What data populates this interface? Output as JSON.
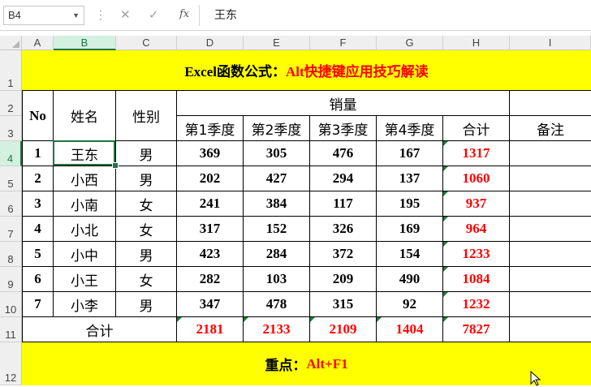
{
  "formula_bar": {
    "name_box": "B4",
    "formula_value": "王东"
  },
  "columns": [
    "A",
    "B",
    "C",
    "D",
    "E",
    "F",
    "G",
    "H",
    "I"
  ],
  "rows": [
    "1",
    "2",
    "3",
    "4",
    "5",
    "6",
    "7",
    "8",
    "9",
    "10",
    "11",
    "12"
  ],
  "sheet": {
    "title_part1": "Excel函数公式：",
    "title_part2": "Alt快捷键应用技巧解读",
    "headers": {
      "no": "No",
      "name": "姓名",
      "gender": "性别",
      "sales": "销量",
      "q1": "第1季度",
      "q2": "第2季度",
      "q3": "第3季度",
      "q4": "第4季度",
      "total": "合计",
      "remark": "备注"
    },
    "data": [
      {
        "no": "1",
        "name": "王东",
        "gender": "男",
        "q1": "369",
        "q2": "305",
        "q3": "476",
        "q4": "167",
        "total": "1317"
      },
      {
        "no": "2",
        "name": "小西",
        "gender": "男",
        "q1": "202",
        "q2": "427",
        "q3": "294",
        "q4": "137",
        "total": "1060"
      },
      {
        "no": "3",
        "name": "小南",
        "gender": "女",
        "q1": "241",
        "q2": "384",
        "q3": "117",
        "q4": "195",
        "total": "937"
      },
      {
        "no": "4",
        "name": "小北",
        "gender": "女",
        "q1": "317",
        "q2": "152",
        "q3": "326",
        "q4": "169",
        "total": "964"
      },
      {
        "no": "5",
        "name": "小中",
        "gender": "男",
        "q1": "423",
        "q2": "284",
        "q3": "372",
        "q4": "154",
        "total": "1233"
      },
      {
        "no": "6",
        "name": "小王",
        "gender": "女",
        "q1": "282",
        "q2": "103",
        "q3": "209",
        "q4": "490",
        "total": "1084"
      },
      {
        "no": "7",
        "name": "小李",
        "gender": "男",
        "q1": "347",
        "q2": "478",
        "q3": "315",
        "q4": "92",
        "total": "1232"
      }
    ],
    "totals": {
      "label": "合计",
      "q1": "2181",
      "q2": "2133",
      "q3": "2109",
      "q4": "1404",
      "total": "7827"
    },
    "footer_label": "重点：",
    "footer_value": "Alt+F1"
  },
  "colors": {
    "highlight": "#ffff00",
    "accent_red": "#ff0000",
    "selection_green": "#217346"
  }
}
